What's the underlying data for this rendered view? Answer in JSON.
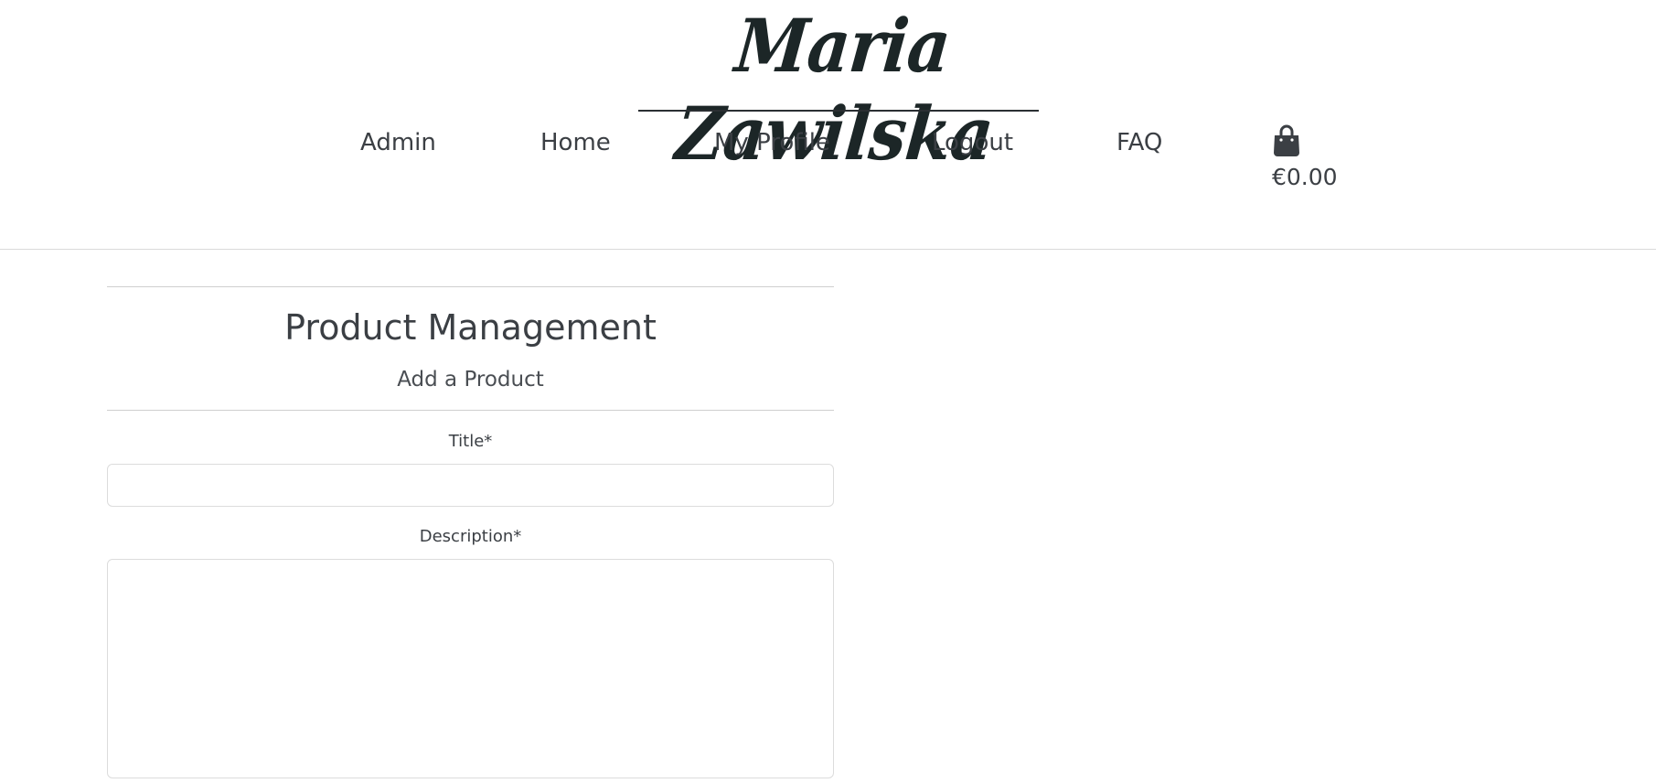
{
  "header": {
    "brand_name": "Maria Zawilska",
    "nav": {
      "admin": "Admin",
      "home": "Home",
      "my_profile": "My Profile",
      "logout": "Logout",
      "faq": "FAQ"
    },
    "cart": {
      "icon": "shopping-bag-icon",
      "total": "€0.00"
    }
  },
  "main": {
    "title": "Product Management",
    "subtitle": "Add a Product",
    "form": {
      "title_label": "Title*",
      "title_value": "",
      "description_label": "Description*",
      "description_value": ""
    }
  },
  "colors": {
    "text": "#3b3f44",
    "brand": "#1c2627",
    "rule": "#cfcfcf",
    "input_border": "#dcdcdc"
  }
}
